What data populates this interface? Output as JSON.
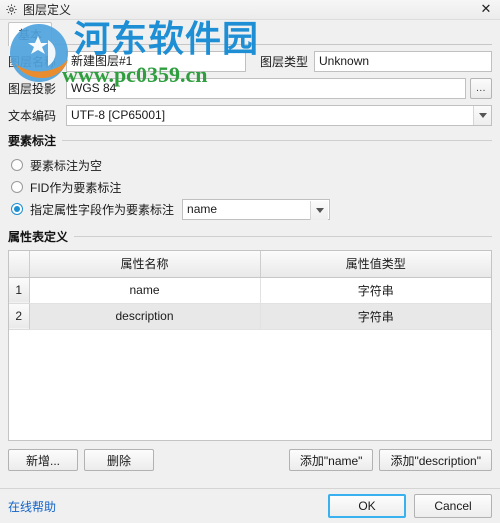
{
  "window": {
    "title": "图层定义",
    "gear_icon": "gear-icon",
    "close_label": "✕"
  },
  "tabs": [
    {
      "label": "基本",
      "active": true
    }
  ],
  "form": {
    "layer_name": {
      "label": "图层名称",
      "value": "新建图层#1",
      "placeholder": ""
    },
    "layer_type": {
      "label": "图层类型",
      "value": "Unknown",
      "placeholder": ""
    },
    "layer_projection": {
      "label": "图层投影",
      "value": "WGS 84",
      "placeholder": "",
      "browse_label": "..."
    },
    "text_encoding": {
      "label": "文本编码",
      "value": "UTF-8 [CP65001]",
      "placeholder": ""
    }
  },
  "feature_label_group": {
    "title": "要素标注",
    "options": [
      {
        "label": "要素标注为空",
        "selected": false
      },
      {
        "label": "FID作为要素标注",
        "selected": false
      },
      {
        "label": "指定属性字段作为要素标注",
        "selected": true
      }
    ],
    "field_combo_value": "name"
  },
  "attribute_table_group": {
    "title": "属性表定义",
    "columns": [
      "",
      "属性名称",
      "属性值类型"
    ],
    "rows": [
      {
        "index": "1",
        "name": "name",
        "type": "字符串"
      },
      {
        "index": "2",
        "name": "description",
        "type": "字符串"
      }
    ]
  },
  "table_actions": {
    "add_label": "新增...",
    "delete_label": "删除",
    "add_name_label": "添加\"name\"",
    "add_description_label": "添加\"description\""
  },
  "footer": {
    "help_label": "在线帮助",
    "ok_label": "OK",
    "cancel_label": "Cancel"
  },
  "watermark": {
    "site_cn": "河东软件园",
    "site_url": "www.pc0359.cn"
  },
  "colors": {
    "accent_focus": "#39b0ef",
    "radio_on": "#1e90d2",
    "link": "#1464c8",
    "watermark_blue": "#1e8fd5",
    "watermark_green": "#2f9e3f",
    "window_bg": "#f0f0f0"
  }
}
